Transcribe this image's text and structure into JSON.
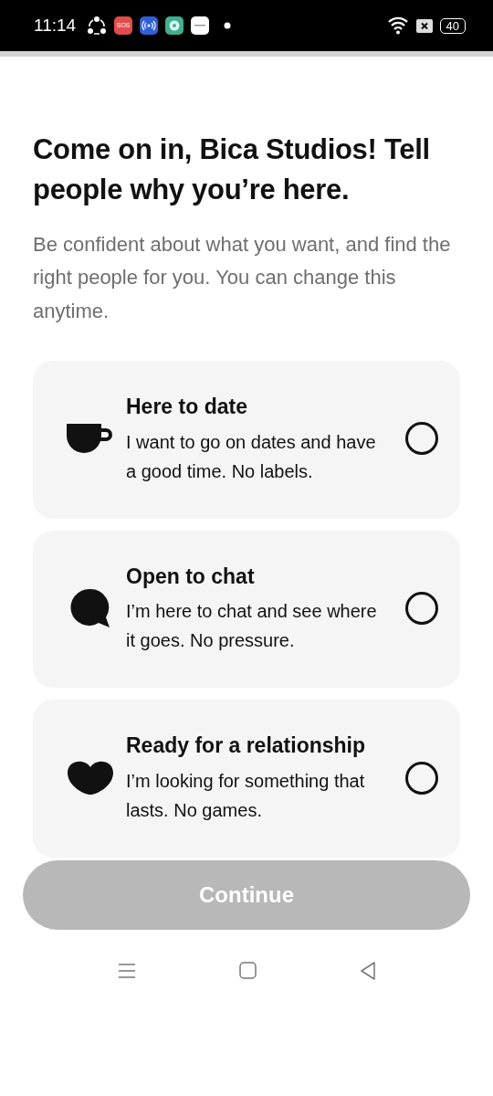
{
  "status_bar": {
    "time": "11:14",
    "sos_label": "SOS",
    "battery": "40"
  },
  "title": "Come on in, Bica Studios! Tell people why you’re here.",
  "subtitle": "Be confident about what you want, and find the right people for you. You can change this anytime.",
  "options": [
    {
      "title": "Here to date",
      "description": "I want to go on dates and have a good time. No labels.",
      "selected": false
    },
    {
      "title": "Open to chat",
      "description": "I’m here to chat and see where it goes. No pressure.",
      "selected": false
    },
    {
      "title": "Ready for a relationship",
      "description": "I’m looking for something that lasts. No games.",
      "selected": false
    }
  ],
  "continue_button": {
    "label": "Continue",
    "disabled": true
  }
}
